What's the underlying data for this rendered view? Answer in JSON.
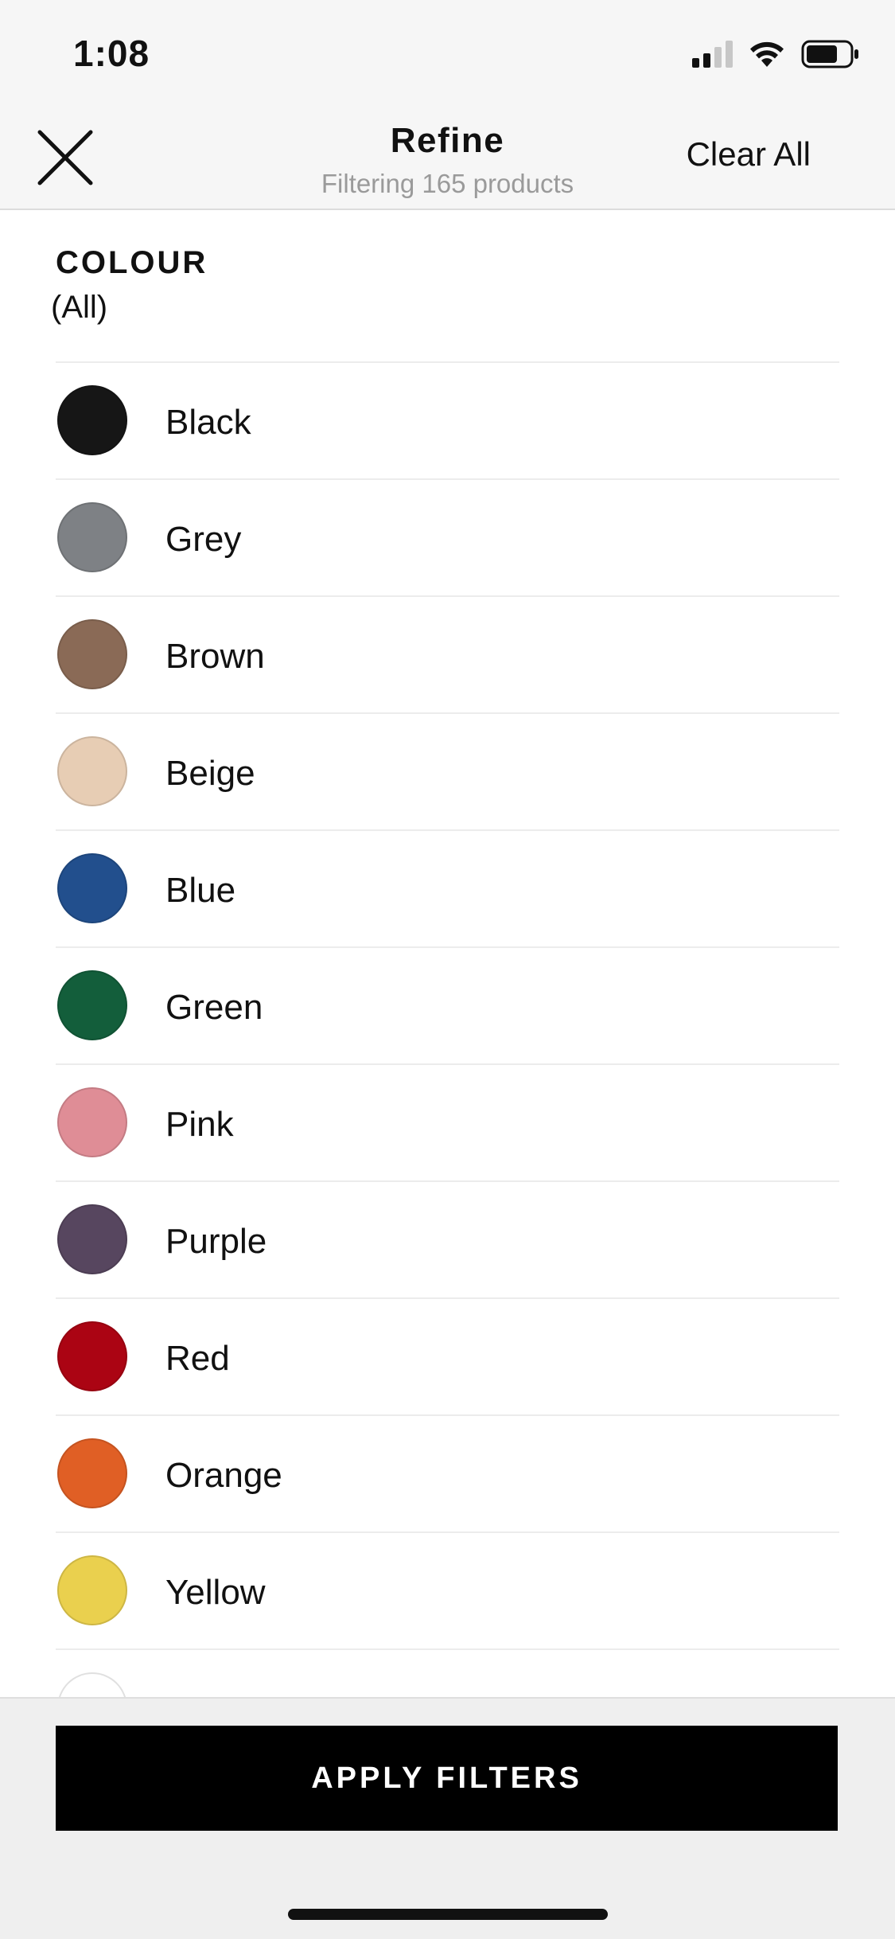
{
  "status_bar": {
    "time": "1:08",
    "icons": [
      "cellular-signal-icon",
      "wifi-icon",
      "battery-icon"
    ]
  },
  "nav": {
    "close_icon": "close-icon",
    "title": "Refine",
    "subtitle": "Filtering 165 products",
    "clear_all_label": "Clear All"
  },
  "filter_section": {
    "title": "COLOUR",
    "selected": "(All)",
    "colours": [
      {
        "label": "Black",
        "color": "#161616"
      },
      {
        "label": "Grey",
        "color": "#7e8185"
      },
      {
        "label": "Brown",
        "color": "#8a6a56"
      },
      {
        "label": "Beige",
        "color": "#e7cdb4"
      },
      {
        "label": "Blue",
        "color": "#224f8d"
      },
      {
        "label": "Green",
        "color": "#135e3b"
      },
      {
        "label": "Pink",
        "color": "#df8d96"
      },
      {
        "label": "Purple",
        "color": "#57465f"
      },
      {
        "label": "Red",
        "color": "#ab0413"
      },
      {
        "label": "Orange",
        "color": "#e05f25"
      },
      {
        "label": "Yellow",
        "color": "#ead04e"
      },
      {
        "label": "",
        "color": "#ffffff"
      }
    ]
  },
  "footer": {
    "apply_label": "APPLY FILTERS"
  }
}
